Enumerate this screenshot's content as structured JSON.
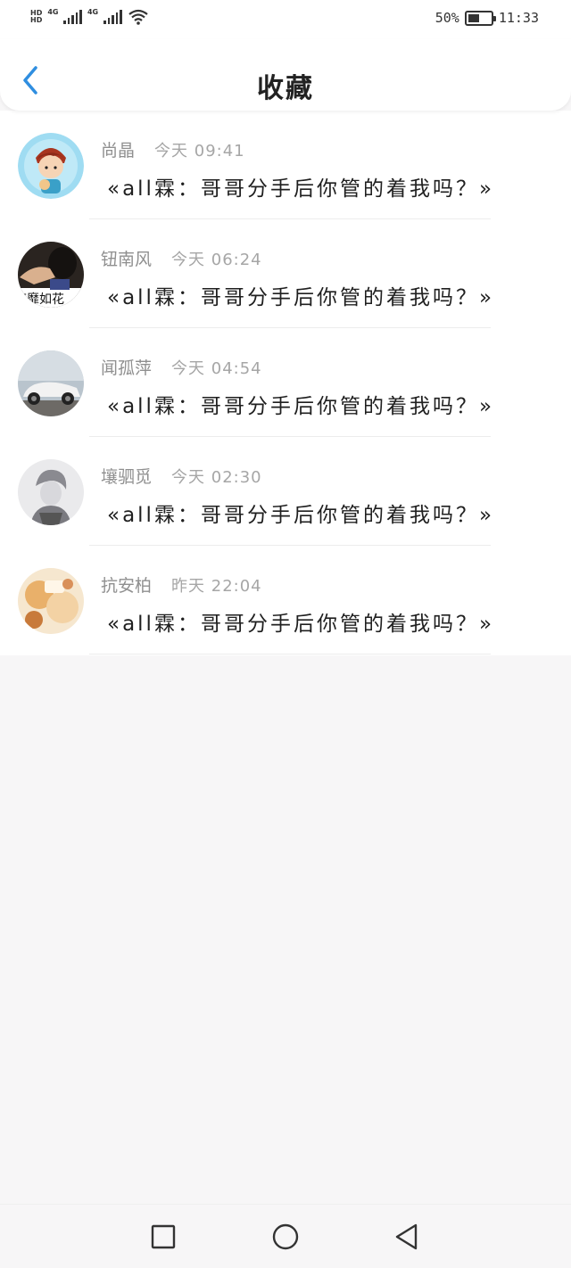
{
  "status_bar": {
    "hd1": "HD",
    "hd2": "HD",
    "net1": "4G",
    "net2": "4G",
    "battery_text": "50%",
    "battery_level": 0.5,
    "time": "11:33"
  },
  "header": {
    "title": "收藏"
  },
  "items": [
    {
      "author": "尚晶",
      "time": "今天 09:41",
      "quote": "«all霖：哥哥分手后你管的着我吗？»"
    },
    {
      "author": "钮南风",
      "time": "今天 06:24",
      "quote": "«all霖：哥哥分手后你管的着我吗？»"
    },
    {
      "author": "闻孤萍",
      "time": "今天 04:54",
      "quote": "«all霖：哥哥分手后你管的着我吗？»"
    },
    {
      "author": "壤驷觅",
      "time": "今天 02:30",
      "quote": "«all霖：哥哥分手后你管的着我吗？»"
    },
    {
      "author": "抗安柏",
      "time": "昨天 22:04",
      "quote": "«all霖：哥哥分手后你管的着我吗？»"
    }
  ],
  "avatar_overlay_text": "李靡如花",
  "colors": {
    "accent": "#2f8ee0",
    "background": "#f7f6f7"
  },
  "icons": {
    "back": "chevron-left-icon",
    "recents": "square-icon",
    "home": "circle-icon",
    "nav_back": "triangle-back-icon"
  }
}
